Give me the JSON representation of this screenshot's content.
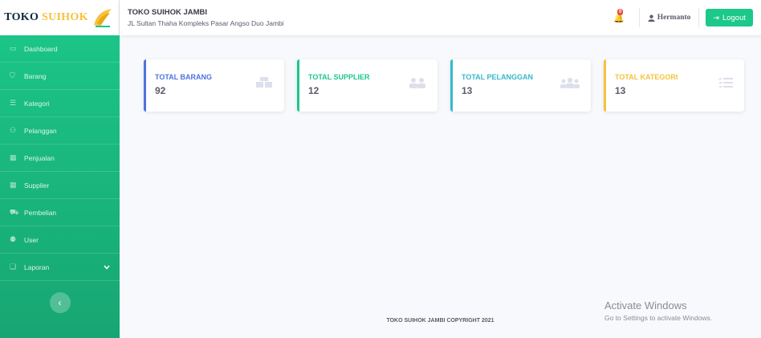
{
  "brand": {
    "text_dark": "TOKO",
    "text_highlight": "SUIHOK"
  },
  "sidebar": {
    "items": [
      {
        "label": "Dashboard",
        "icon": "monitor-icon",
        "glyph": "▭"
      },
      {
        "label": "Barang",
        "icon": "box-icon",
        "glyph": "⛉"
      },
      {
        "label": "Kategori",
        "icon": "list-icon",
        "glyph": "☰"
      },
      {
        "label": "Pelanggan",
        "icon": "users-icon",
        "glyph": "⚇"
      },
      {
        "label": "Penjualan",
        "icon": "table-icon",
        "glyph": "▦"
      },
      {
        "label": "Supplier",
        "icon": "table-icon",
        "glyph": "▦"
      },
      {
        "label": "Pembelian",
        "icon": "cart-icon",
        "glyph": "⛟"
      },
      {
        "label": "User",
        "icon": "user-icon",
        "glyph": "⚉"
      },
      {
        "label": "Laporan",
        "icon": "report-icon",
        "glyph": "❏"
      }
    ],
    "toggle_glyph": "‹"
  },
  "topbar": {
    "store_name": "TOKO SUIHOK JAMBI",
    "store_address": "JL Sultan Thaha Kompleks Pasar Angso Duo Jambi",
    "alert_count": "0",
    "user_name": "Hermanto",
    "logout_label": "Logout"
  },
  "cards": [
    {
      "title": "TOTAL BARANG",
      "value": "92",
      "color": "#4e73df",
      "icon": "boxes-icon"
    },
    {
      "title": "TOTAL SUPPLIER",
      "value": "12",
      "color": "#1cc88a",
      "icon": "user-friends-icon"
    },
    {
      "title": "TOTAL PELANGGAN",
      "value": "13",
      "color": "#36b9cc",
      "icon": "users-group-icon"
    },
    {
      "title": "TOTAL KATEGORI",
      "value": "13",
      "color": "#f6c23e",
      "icon": "tasks-icon"
    }
  ],
  "footer": {
    "copyright": "TOKO SUIHOK JAMBI COPYRIGHT 2021"
  },
  "watermark": {
    "line1": "Activate Windows",
    "line2": "Go to Settings to activate Windows."
  }
}
